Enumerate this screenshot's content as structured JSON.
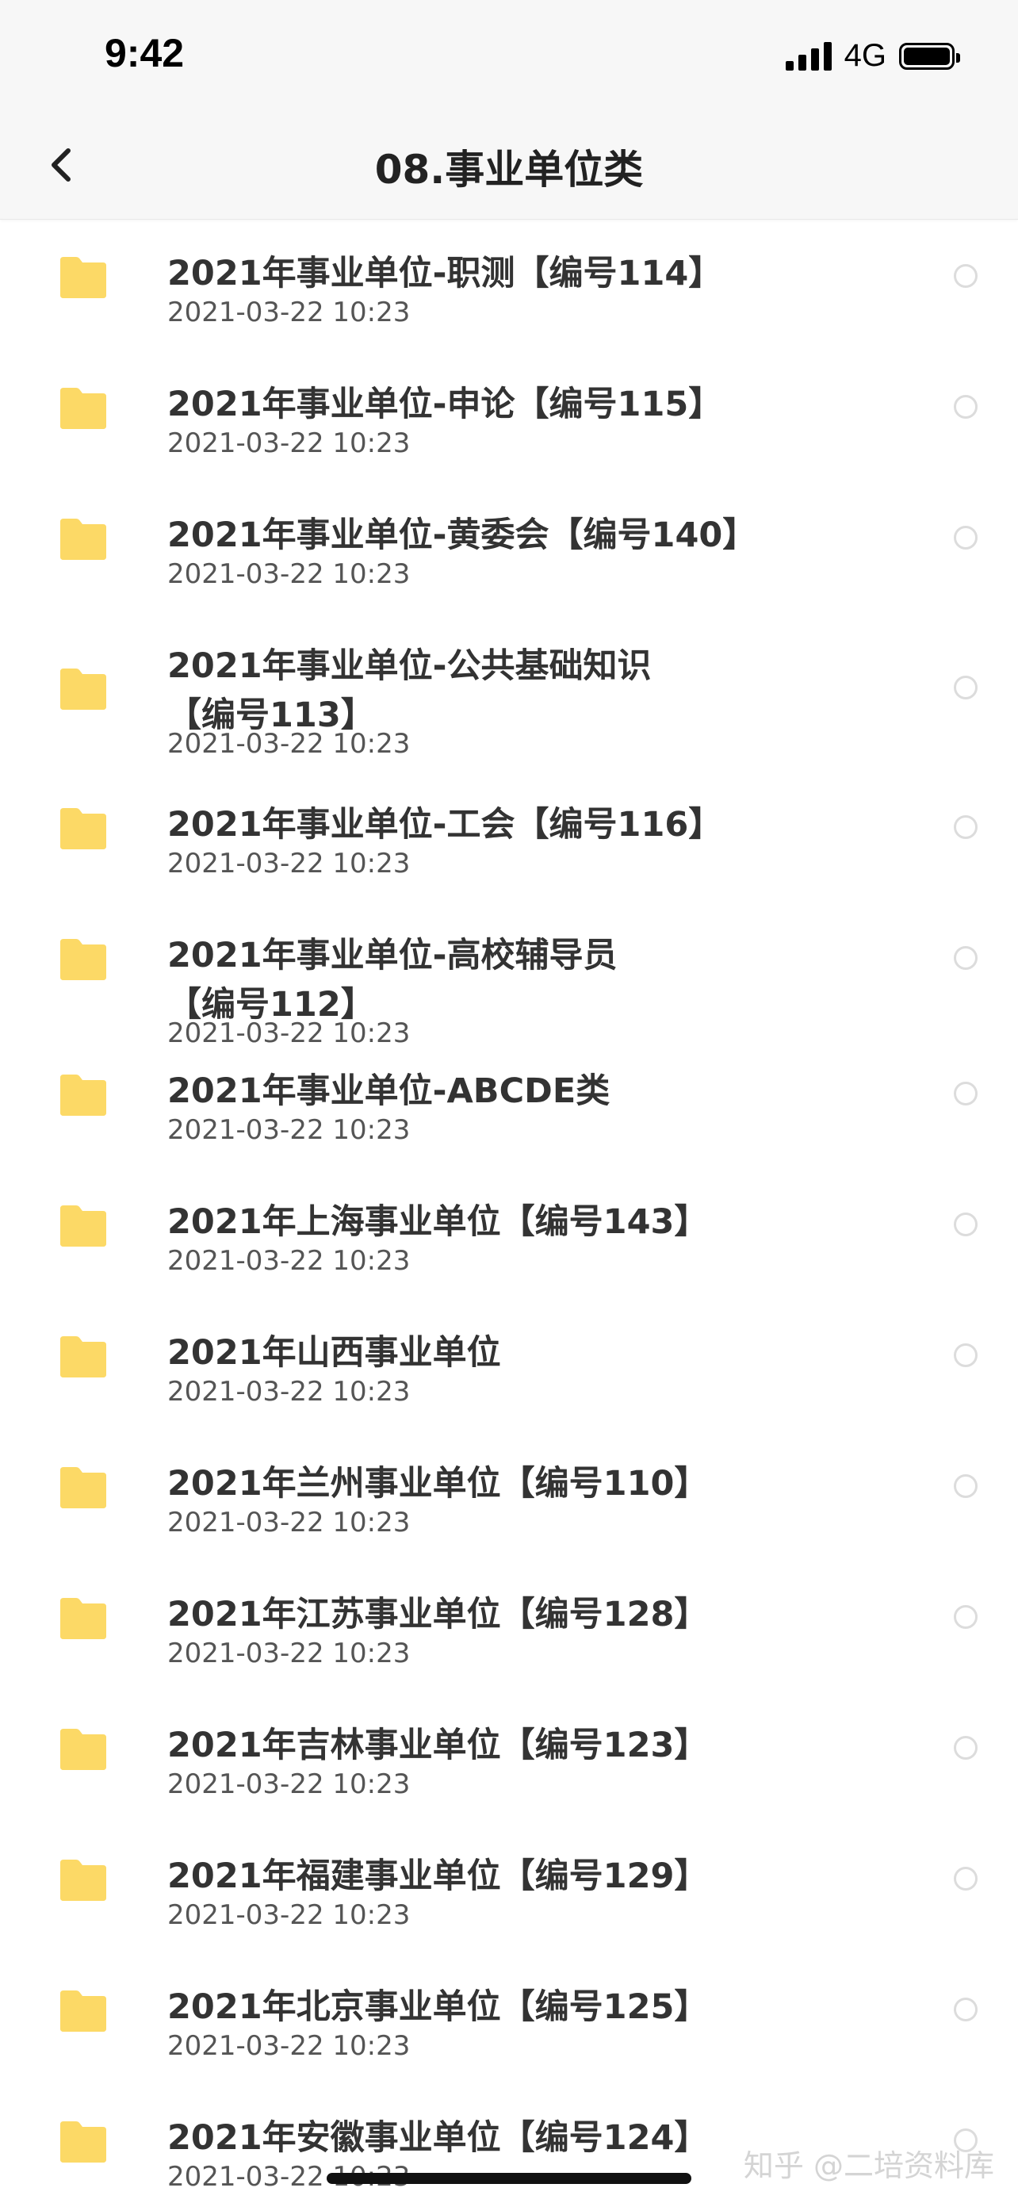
{
  "status_bar": {
    "time": "9:42",
    "network": "4G"
  },
  "nav": {
    "title": "08.事业单位类",
    "back_icon": "chevron-left-icon"
  },
  "colors": {
    "folder": "#FCD966",
    "radio_border": "#DCDCDC"
  },
  "items": [
    {
      "name": "2021年事业单位-职测【编号114】",
      "date": "2021-03-22 10:23"
    },
    {
      "name": "2021年事业单位-申论【编号115】",
      "date": "2021-03-22 10:23"
    },
    {
      "name": "2021年事业单位-黄委会【编号140】",
      "date": "2021-03-22 10:23"
    },
    {
      "name_line1": "2021年事业单位-公共基础知识",
      "name_line2": "【编号113】",
      "date": "2021-03-22 10:23"
    },
    {
      "name": "2021年事业单位-工会【编号116】",
      "date": "2021-03-22 10:23"
    },
    {
      "name_line1": "2021年事业单位-高校辅导员",
      "name_line2": "【编号112】",
      "date": "2021-03-22 10:23"
    },
    {
      "name": "2021年事业单位-ABCDE类",
      "date": "2021-03-22 10:23"
    },
    {
      "name": "2021年上海事业单位【编号143】",
      "date": "2021-03-22 10:23"
    },
    {
      "name": "2021年山西事业单位",
      "date": "2021-03-22 10:23"
    },
    {
      "name": "2021年兰州事业单位【编号110】",
      "date": "2021-03-22 10:23"
    },
    {
      "name": "2021年江苏事业单位【编号128】",
      "date": "2021-03-22 10:23"
    },
    {
      "name": "2021年吉林事业单位【编号123】",
      "date": "2021-03-22 10:23"
    },
    {
      "name": "2021年福建事业单位【编号129】",
      "date": "2021-03-22 10:23"
    },
    {
      "name": "2021年北京事业单位【编号125】",
      "date": "2021-03-22 10:23"
    },
    {
      "name": "2021年安徽事业单位【编号124】",
      "date": "2021-03-22 10:23"
    }
  ],
  "watermark": "知乎 @二培资料库"
}
